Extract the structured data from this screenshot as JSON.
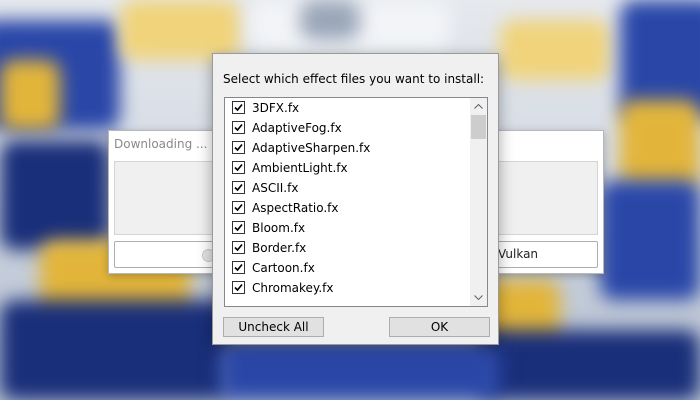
{
  "back_window": {
    "title": "Downloading ...",
    "button_label": "Vulkan"
  },
  "dialog": {
    "prompt": "Select which effect files you want to install:",
    "items": [
      {
        "label": "3DFX.fx",
        "checked": true
      },
      {
        "label": "AdaptiveFog.fx",
        "checked": true
      },
      {
        "label": "AdaptiveSharpen.fx",
        "checked": true
      },
      {
        "label": "AmbientLight.fx",
        "checked": true
      },
      {
        "label": "ASCII.fx",
        "checked": true
      },
      {
        "label": "AspectRatio.fx",
        "checked": true
      },
      {
        "label": "Bloom.fx",
        "checked": true
      },
      {
        "label": "Border.fx",
        "checked": true
      },
      {
        "label": "Cartoon.fx",
        "checked": true
      },
      {
        "label": "Chromakey.fx",
        "checked": true
      }
    ],
    "uncheck_all_label": "Uncheck All",
    "ok_label": "OK"
  },
  "icons": {
    "scroll_up": "chevron-up-icon",
    "scroll_down": "chevron-down-icon",
    "checkmark": "checkmark-icon"
  }
}
